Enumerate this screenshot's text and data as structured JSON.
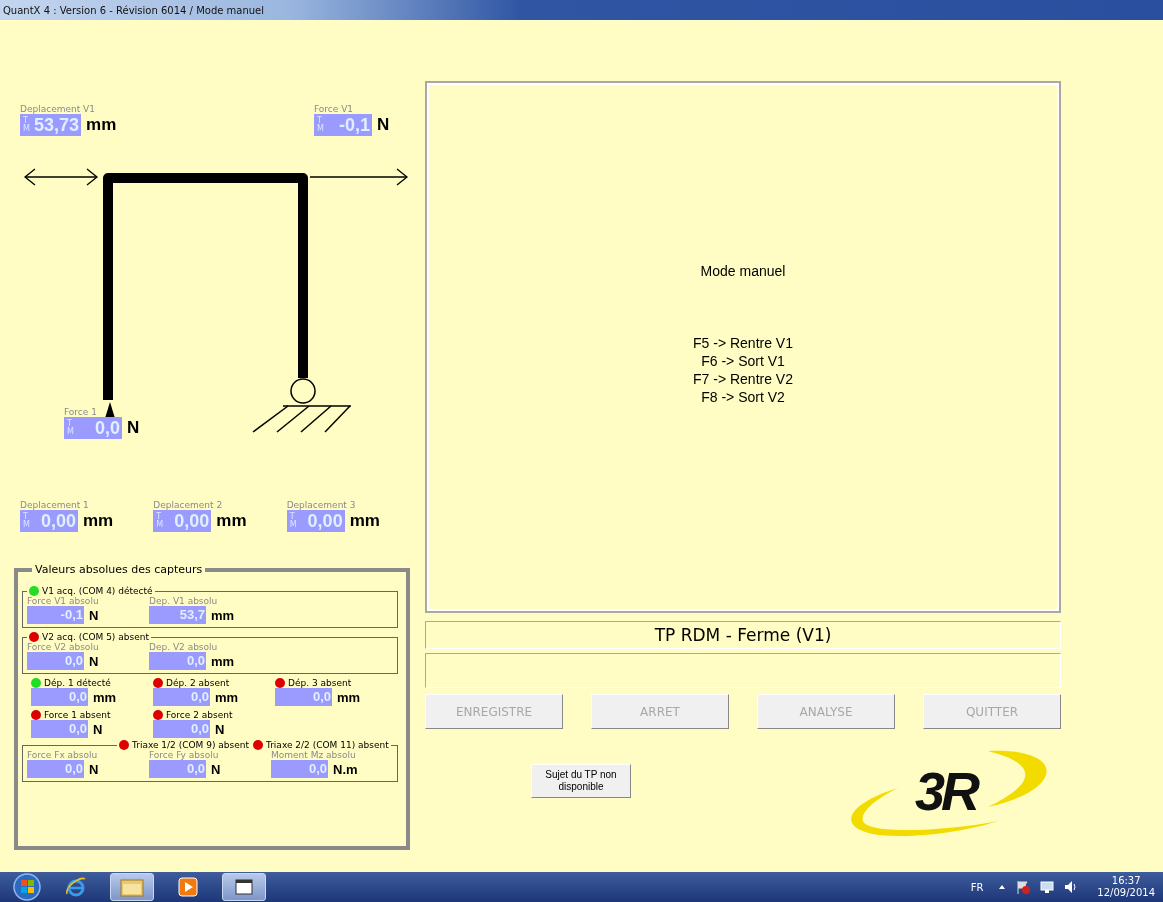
{
  "window": {
    "title": "QuantX 4 : Version 6 - Révision 6014 / Mode manuel"
  },
  "diagram": {
    "readouts": [
      {
        "label": "Deplacement V1",
        "mode_top": "T",
        "mode_bottom": "M",
        "value": "53,73",
        "unit": "mm"
      },
      {
        "label": "Force V1",
        "mode_top": "T",
        "mode_bottom": "M",
        "value": "-0,1",
        "unit": "N"
      },
      {
        "label": "Force 1",
        "mode_top": "T",
        "mode_bottom": "M",
        "value": "0,0",
        "unit": "N"
      }
    ]
  },
  "displacements": [
    {
      "label": "Deplacement 1",
      "mode_top": "T",
      "mode_bottom": "M",
      "value": "0,00",
      "unit": "mm"
    },
    {
      "label": "Deplacement 2",
      "mode_top": "T",
      "mode_bottom": "M",
      "value": "0,00",
      "unit": "mm"
    },
    {
      "label": "Deplacement 3",
      "mode_top": "T",
      "mode_bottom": "M",
      "value": "0,00",
      "unit": "mm"
    }
  ],
  "sensor_panel": {
    "title": "Valeurs absolues des capteurs",
    "blocks": [
      {
        "kind": "group",
        "statuses": [
          {
            "label": "V1 acq. (COM 4) détecté",
            "color": "#22dd22"
          }
        ],
        "fields": [
          {
            "label": "Force V1 absolu",
            "value": "-0,1",
            "unit": "N"
          },
          {
            "label": "Dep. V1 absolu",
            "value": "53,7",
            "unit": "mm"
          }
        ]
      },
      {
        "kind": "group",
        "statuses": [
          {
            "label": "V2 acq. (COM 5) absent",
            "color": "#dd0000"
          }
        ],
        "fields": [
          {
            "label": "Force V2 absolu",
            "value": "0,0",
            "unit": "N"
          },
          {
            "label": "Dep. V2 absolu",
            "value": "0,0",
            "unit": "mm"
          }
        ]
      },
      {
        "kind": "row",
        "items": [
          {
            "status": {
              "label": "Dép. 1 détecté",
              "color": "#22dd22"
            },
            "value": "0,0",
            "unit": "mm"
          },
          {
            "status": {
              "label": "Dép. 2 absent",
              "color": "#dd0000"
            },
            "value": "0,0",
            "unit": "mm"
          },
          {
            "status": {
              "label": "Dép. 3 absent",
              "color": "#dd0000"
            },
            "value": "0,0",
            "unit": "mm"
          }
        ]
      },
      {
        "kind": "row",
        "items": [
          {
            "status": {
              "label": "Force 1 absent",
              "color": "#dd0000"
            },
            "value": "0,0",
            "unit": "N"
          },
          {
            "status": {
              "label": "Force 2 absent",
              "color": "#dd0000"
            },
            "value": "0,0",
            "unit": "N"
          }
        ]
      },
      {
        "kind": "frame",
        "statuses": [
          {
            "label": "Triaxe 1/2 (COM 9) absent",
            "color": "#dd0000"
          },
          {
            "label": "Triaxe 2/2 (COM 11) absent",
            "color": "#dd0000"
          }
        ],
        "fields": [
          {
            "label": "Force Fx absolu",
            "value": "0,0",
            "unit": "N"
          },
          {
            "label": "Force Fy absolu",
            "value": "0,0",
            "unit": "N"
          },
          {
            "label": "Moment Mz absolu",
            "value": "0,0",
            "unit": "N.m"
          }
        ]
      }
    ]
  },
  "instructions": {
    "heading": "Mode manuel",
    "lines": [
      "F5 -> Rentre V1",
      "F6 -> Sort V1",
      "F7 -> Rentre V2",
      "F8 -> Sort V2"
    ]
  },
  "exercise_title": "TP RDM - Ferme (V1)",
  "buttons": [
    {
      "label": "ENREGISTRE",
      "disabled": true
    },
    {
      "label": "ARRET",
      "disabled": true
    },
    {
      "label": "ANALYSE",
      "disabled": true
    },
    {
      "label": "QUITTER",
      "disabled": true
    }
  ],
  "subject_button": {
    "label": "Sujet du TP non disponible"
  },
  "logo": {
    "text": "3R"
  },
  "taskbar": {
    "apps": [
      {
        "kind": "browser",
        "selected": false
      },
      {
        "kind": "folder",
        "selected": true
      },
      {
        "kind": "media",
        "selected": false
      },
      {
        "kind": "window",
        "selected": true
      }
    ],
    "language": "FR",
    "time": "16:37",
    "date": "12/09/2014"
  }
}
